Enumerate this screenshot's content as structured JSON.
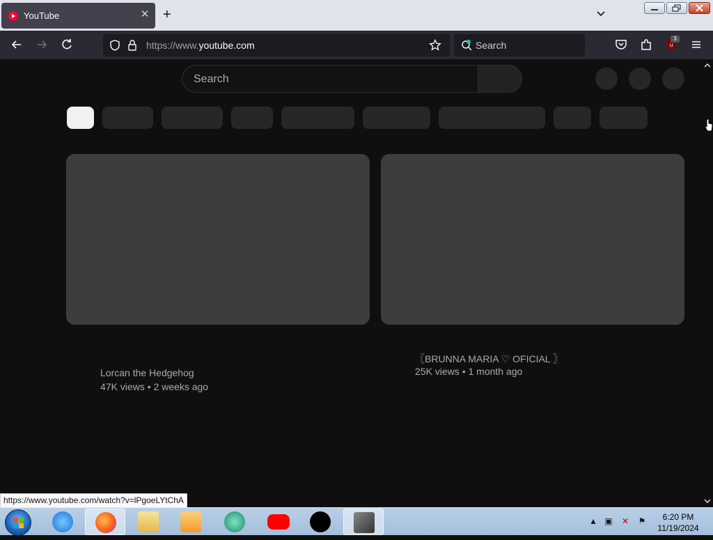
{
  "browser": {
    "tab_title": "YouTube",
    "close_tab_glyph": "✕",
    "new_tab_glyph": "+",
    "url_prefix": "https://www.",
    "url_domain": "youtube.com",
    "search_placeholder": "Search",
    "extension_badge": "3",
    "status_url": "https://www.youtube.com/watch?v=lPgoeLYtChA"
  },
  "youtube": {
    "search_placeholder": "Search",
    "videos": [
      {
        "channel": "Lorcan the Hedgehog",
        "meta": "47K views • 2 weeks ago"
      },
      {
        "channel": "〖BRUNNA MARIA ♡ OFICIAL 〗",
        "meta": "25K views • 1 month ago"
      }
    ]
  },
  "taskbar": {
    "time": "6:20 PM",
    "date": "11/19/2024"
  },
  "icons": {
    "back": "arrow-left-icon",
    "forward": "arrow-right-icon",
    "reload": "reload-icon",
    "shield": "shield-icon",
    "lock": "lock-icon",
    "star": "star-icon",
    "pocket": "pocket-icon",
    "extensions": "puzzle-icon",
    "menu": "hamburger-icon"
  }
}
